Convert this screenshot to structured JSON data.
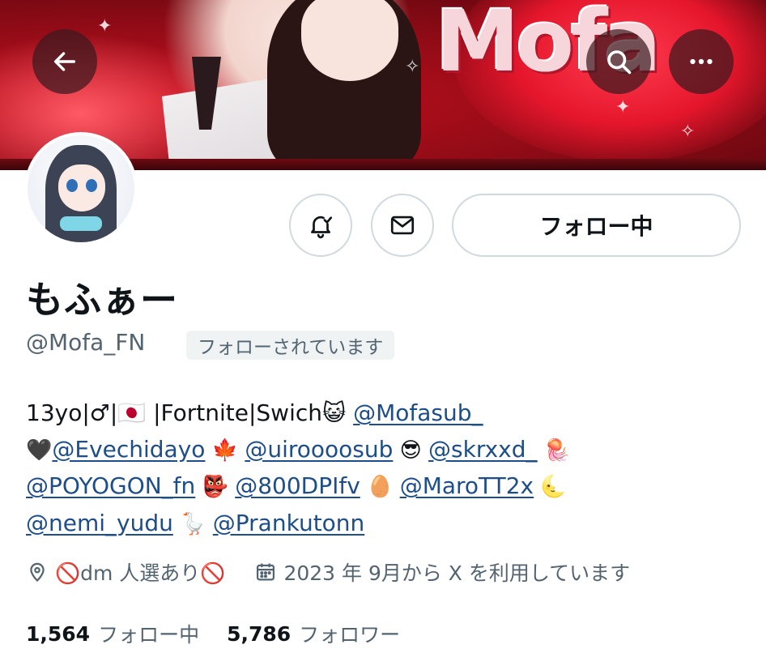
{
  "header": {
    "back_icon": "arrow-left-icon",
    "search_icon": "search-icon",
    "more_icon": "more-horizontal-icon",
    "banner_logo_text": "Mofa"
  },
  "actions": {
    "notify_icon": "bell-icon",
    "message_icon": "mail-icon",
    "follow_label": "フォロー中"
  },
  "profile": {
    "display_name": "もふぁー",
    "handle": "@Mofa_FN",
    "follows_you_badge": "フォローされています"
  },
  "bio": {
    "line1_text": "13yo|♂|🇯🇵 |Fortnite|Swich😺 ",
    "link_mofasub": "@Mofasub_",
    "line2_prefix": "🖤",
    "link_evechidayo": "@Evechidayo",
    "emoji_leaf": " 🍁 ",
    "link_uiroooosub": "@uiroooosub",
    "emoji_cool": " 😎 ",
    "link_skrxxd": "@skrxxd_",
    "emoji_jelly": " 🪼",
    "link_poyogon": "@POYOGON_fn",
    "emoji_tengu": " 👺 ",
    "link_800dpi": "@800DPIfv",
    "emoji_egg": " 🥚 ",
    "link_marott": "@MaroTT2x",
    "emoji_moon": " 🌜",
    "link_nemi": "@nemi_yudu",
    "emoji_goose": " 🪿 ",
    "link_prank": "@Prankutonn"
  },
  "meta": {
    "location_icon": "location-pin-icon",
    "location": "🚫dm 人選あり🚫",
    "calendar_icon": "calendar-icon",
    "joined": "2023 年 9月から X を利用しています"
  },
  "stats": {
    "following_count": "1,564",
    "following_label": "フォロー中",
    "followers_count": "5,786",
    "followers_label": "フォロワー"
  },
  "colors": {
    "link": "#1d4e89",
    "muted": "#536471",
    "border": "#cfd9de",
    "banner_red": "#c8101e"
  }
}
